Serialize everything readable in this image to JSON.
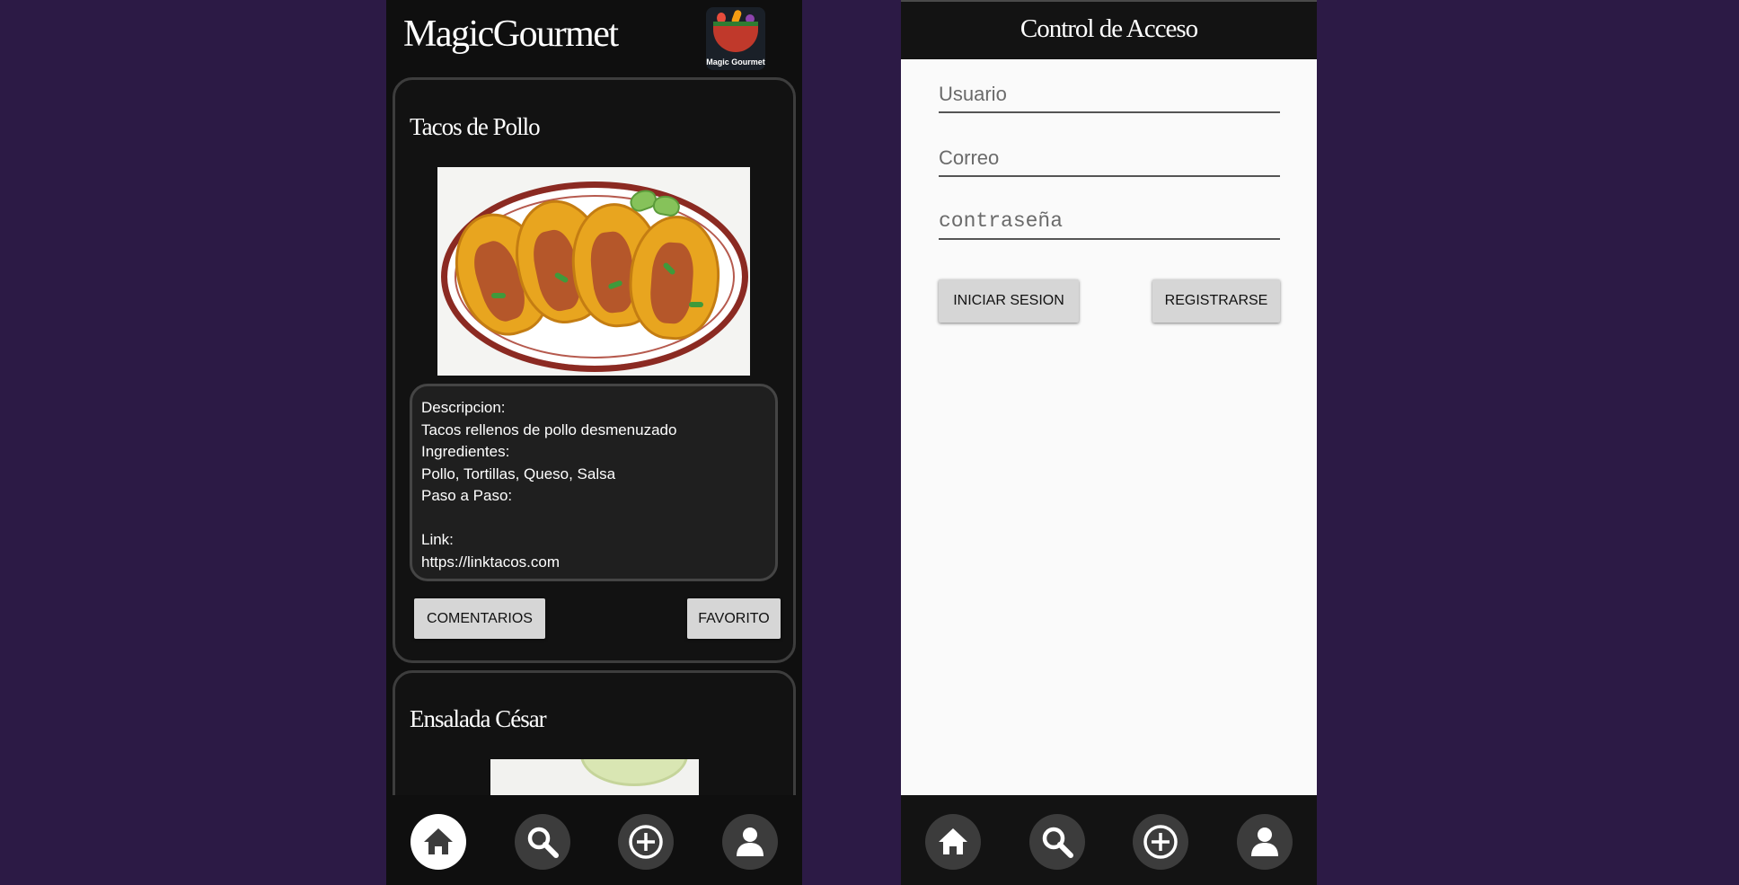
{
  "feed_screen": {
    "app_title": "MagicGourmet",
    "logo_text": "Magic Gourmet",
    "recipes": [
      {
        "title": "Tacos de Pollo",
        "image": "tacos-photo",
        "description_lines": [
          "Descripcion:",
          "Tacos rellenos de pollo desmenuzado",
          "Ingredientes:",
          "Pollo, Tortillas, Queso, Salsa",
          "Paso a Paso:",
          "",
          "Link:",
          "https://linktacos.com"
        ],
        "comments_label": "COMENTARIOS",
        "favorite_label": "FAVORITO"
      },
      {
        "title": "Ensalada César",
        "image": "salad-photo"
      }
    ],
    "nav": [
      {
        "icon": "home-icon",
        "active": true
      },
      {
        "icon": "search-icon",
        "active": false
      },
      {
        "icon": "add-circle-icon",
        "active": false
      },
      {
        "icon": "profile-icon",
        "active": false
      }
    ]
  },
  "login_screen": {
    "title": "Control de Acceso",
    "username_placeholder": "Usuario",
    "email_placeholder": "Correo",
    "password_placeholder": "contraseña",
    "login_label": "INICIAR SESION",
    "register_label": "REGISTRARSE",
    "nav": [
      {
        "icon": "home-icon",
        "active": false
      },
      {
        "icon": "search-icon",
        "active": false
      },
      {
        "icon": "add-circle-icon",
        "active": false
      },
      {
        "icon": "profile-icon",
        "active": false
      }
    ]
  },
  "colors": {
    "background": "#2c1a45",
    "app_dark": "#0f0f0f",
    "button_gray": "#d6d6d6",
    "nav_inactive": "#3c3c3c"
  }
}
